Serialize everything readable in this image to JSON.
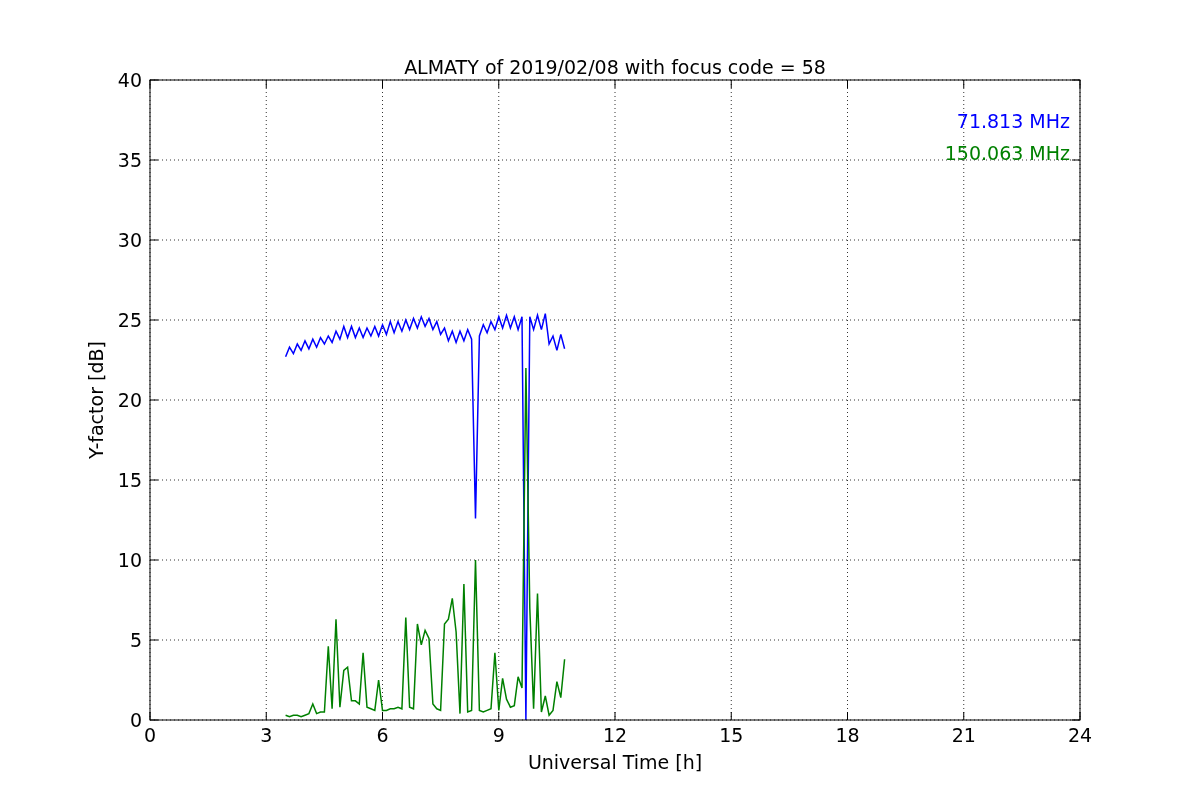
{
  "chart_data": {
    "type": "line",
    "title": "ALMATY of 2019/02/08 with focus code = 58",
    "xlabel": "Universal Time [h]",
    "ylabel": "Y-factor [dB]",
    "x": [
      3.5,
      3.6,
      3.7,
      3.8,
      3.9,
      4.0,
      4.1,
      4.2,
      4.3,
      4.4,
      4.5,
      4.6,
      4.7,
      4.8,
      4.9,
      5.0,
      5.1,
      5.2,
      5.3,
      5.4,
      5.5,
      5.6,
      5.7,
      5.8,
      5.9,
      6.0,
      6.1,
      6.2,
      6.3,
      6.4,
      6.5,
      6.6,
      6.7,
      6.8,
      6.9,
      7.0,
      7.1,
      7.2,
      7.3,
      7.4,
      7.5,
      7.6,
      7.7,
      7.8,
      7.9,
      8.0,
      8.1,
      8.2,
      8.3,
      8.4,
      8.5,
      8.6,
      8.7,
      8.8,
      8.9,
      9.0,
      9.1,
      9.2,
      9.3,
      9.4,
      9.5,
      9.6,
      9.7,
      9.8,
      9.9,
      10.0,
      10.1,
      10.2,
      10.3,
      10.4,
      10.5,
      10.6,
      10.7
    ],
    "series": [
      {
        "name": "71.813 MHz",
        "color": "#0000ff",
        "values": [
          22.7,
          23.3,
          22.9,
          23.5,
          23.1,
          23.7,
          23.2,
          23.8,
          23.3,
          23.9,
          23.5,
          24.0,
          23.6,
          24.3,
          23.8,
          24.6,
          23.9,
          24.6,
          23.9,
          24.5,
          23.9,
          24.5,
          24.0,
          24.6,
          24.0,
          24.7,
          24.1,
          24.9,
          24.2,
          24.9,
          24.3,
          25.0,
          24.4,
          25.1,
          24.5,
          25.2,
          24.6,
          25.1,
          24.4,
          24.9,
          24.1,
          24.5,
          23.7,
          24.3,
          23.6,
          24.3,
          23.7,
          24.4,
          23.8,
          12.6,
          24.0,
          24.7,
          24.2,
          24.9,
          24.4,
          25.2,
          24.5,
          25.3,
          24.5,
          25.2,
          24.4,
          25.2,
          0,
          25.2,
          24.4,
          25.3,
          24.4,
          25.4,
          23.5,
          24.0,
          23.1,
          24.1,
          23.2
        ]
      },
      {
        "name": "150.063 MHz",
        "color": "#008000",
        "values": [
          0.3,
          0.2,
          0.3,
          0.3,
          0.2,
          0.3,
          0.4,
          1.0,
          0.4,
          0.5,
          0.5,
          4.6,
          0.7,
          6.3,
          0.8,
          3.1,
          3.3,
          1.2,
          1.2,
          1.0,
          4.2,
          0.8,
          0.7,
          0.6,
          2.5,
          0.6,
          0.6,
          0.7,
          0.7,
          0.8,
          0.7,
          6.4,
          0.8,
          0.7,
          6.0,
          4.7,
          5.6,
          5.1,
          1.0,
          0.7,
          0.6,
          6.0,
          6.3,
          7.6,
          5.5,
          0.4,
          8.5,
          0.5,
          0.6,
          10.0,
          0.6,
          0.5,
          0.6,
          0.7,
          4.2,
          0.6,
          2.6,
          1.3,
          0.8,
          0.9,
          2.7,
          2.0,
          22.0,
          7.0,
          0.7,
          7.9,
          0.5,
          1.5,
          0.3,
          0.6,
          2.4,
          1.4,
          3.8
        ]
      }
    ],
    "grid": true,
    "xlim": [
      0,
      24
    ],
    "ylim": [
      0,
      40
    ],
    "xticks": [
      0,
      3,
      6,
      9,
      12,
      15,
      18,
      21,
      24
    ],
    "yticks": [
      0,
      5,
      10,
      15,
      20,
      25,
      30,
      35,
      40
    ]
  }
}
